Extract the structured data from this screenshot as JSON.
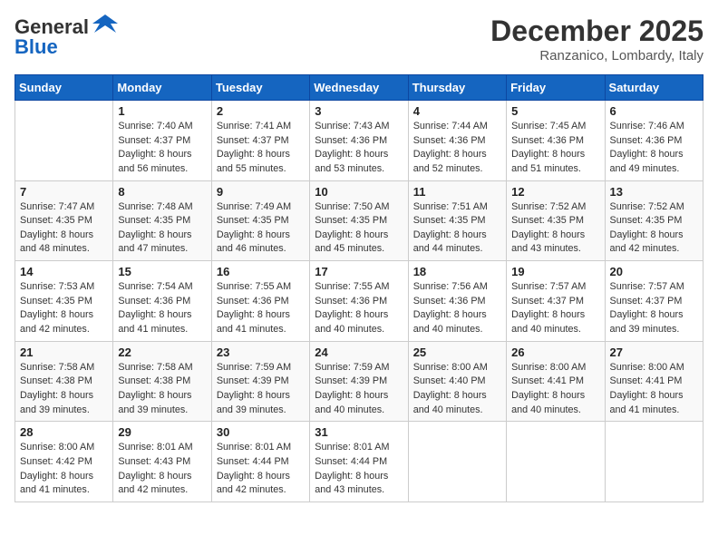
{
  "header": {
    "logo_line1": "General",
    "logo_line2": "Blue",
    "month": "December 2025",
    "location": "Ranzanico, Lombardy, Italy"
  },
  "weekdays": [
    "Sunday",
    "Monday",
    "Tuesday",
    "Wednesday",
    "Thursday",
    "Friday",
    "Saturday"
  ],
  "weeks": [
    [
      {
        "day": "",
        "sunrise": "",
        "sunset": "",
        "daylight": ""
      },
      {
        "day": "1",
        "sunrise": "Sunrise: 7:40 AM",
        "sunset": "Sunset: 4:37 PM",
        "daylight": "Daylight: 8 hours and 56 minutes."
      },
      {
        "day": "2",
        "sunrise": "Sunrise: 7:41 AM",
        "sunset": "Sunset: 4:37 PM",
        "daylight": "Daylight: 8 hours and 55 minutes."
      },
      {
        "day": "3",
        "sunrise": "Sunrise: 7:43 AM",
        "sunset": "Sunset: 4:36 PM",
        "daylight": "Daylight: 8 hours and 53 minutes."
      },
      {
        "day": "4",
        "sunrise": "Sunrise: 7:44 AM",
        "sunset": "Sunset: 4:36 PM",
        "daylight": "Daylight: 8 hours and 52 minutes."
      },
      {
        "day": "5",
        "sunrise": "Sunrise: 7:45 AM",
        "sunset": "Sunset: 4:36 PM",
        "daylight": "Daylight: 8 hours and 51 minutes."
      },
      {
        "day": "6",
        "sunrise": "Sunrise: 7:46 AM",
        "sunset": "Sunset: 4:36 PM",
        "daylight": "Daylight: 8 hours and 49 minutes."
      }
    ],
    [
      {
        "day": "7",
        "sunrise": "Sunrise: 7:47 AM",
        "sunset": "Sunset: 4:35 PM",
        "daylight": "Daylight: 8 hours and 48 minutes."
      },
      {
        "day": "8",
        "sunrise": "Sunrise: 7:48 AM",
        "sunset": "Sunset: 4:35 PM",
        "daylight": "Daylight: 8 hours and 47 minutes."
      },
      {
        "day": "9",
        "sunrise": "Sunrise: 7:49 AM",
        "sunset": "Sunset: 4:35 PM",
        "daylight": "Daylight: 8 hours and 46 minutes."
      },
      {
        "day": "10",
        "sunrise": "Sunrise: 7:50 AM",
        "sunset": "Sunset: 4:35 PM",
        "daylight": "Daylight: 8 hours and 45 minutes."
      },
      {
        "day": "11",
        "sunrise": "Sunrise: 7:51 AM",
        "sunset": "Sunset: 4:35 PM",
        "daylight": "Daylight: 8 hours and 44 minutes."
      },
      {
        "day": "12",
        "sunrise": "Sunrise: 7:52 AM",
        "sunset": "Sunset: 4:35 PM",
        "daylight": "Daylight: 8 hours and 43 minutes."
      },
      {
        "day": "13",
        "sunrise": "Sunrise: 7:52 AM",
        "sunset": "Sunset: 4:35 PM",
        "daylight": "Daylight: 8 hours and 42 minutes."
      }
    ],
    [
      {
        "day": "14",
        "sunrise": "Sunrise: 7:53 AM",
        "sunset": "Sunset: 4:35 PM",
        "daylight": "Daylight: 8 hours and 42 minutes."
      },
      {
        "day": "15",
        "sunrise": "Sunrise: 7:54 AM",
        "sunset": "Sunset: 4:36 PM",
        "daylight": "Daylight: 8 hours and 41 minutes."
      },
      {
        "day": "16",
        "sunrise": "Sunrise: 7:55 AM",
        "sunset": "Sunset: 4:36 PM",
        "daylight": "Daylight: 8 hours and 41 minutes."
      },
      {
        "day": "17",
        "sunrise": "Sunrise: 7:55 AM",
        "sunset": "Sunset: 4:36 PM",
        "daylight": "Daylight: 8 hours and 40 minutes."
      },
      {
        "day": "18",
        "sunrise": "Sunrise: 7:56 AM",
        "sunset": "Sunset: 4:36 PM",
        "daylight": "Daylight: 8 hours and 40 minutes."
      },
      {
        "day": "19",
        "sunrise": "Sunrise: 7:57 AM",
        "sunset": "Sunset: 4:37 PM",
        "daylight": "Daylight: 8 hours and 40 minutes."
      },
      {
        "day": "20",
        "sunrise": "Sunrise: 7:57 AM",
        "sunset": "Sunset: 4:37 PM",
        "daylight": "Daylight: 8 hours and 39 minutes."
      }
    ],
    [
      {
        "day": "21",
        "sunrise": "Sunrise: 7:58 AM",
        "sunset": "Sunset: 4:38 PM",
        "daylight": "Daylight: 8 hours and 39 minutes."
      },
      {
        "day": "22",
        "sunrise": "Sunrise: 7:58 AM",
        "sunset": "Sunset: 4:38 PM",
        "daylight": "Daylight: 8 hours and 39 minutes."
      },
      {
        "day": "23",
        "sunrise": "Sunrise: 7:59 AM",
        "sunset": "Sunset: 4:39 PM",
        "daylight": "Daylight: 8 hours and 39 minutes."
      },
      {
        "day": "24",
        "sunrise": "Sunrise: 7:59 AM",
        "sunset": "Sunset: 4:39 PM",
        "daylight": "Daylight: 8 hours and 40 minutes."
      },
      {
        "day": "25",
        "sunrise": "Sunrise: 8:00 AM",
        "sunset": "Sunset: 4:40 PM",
        "daylight": "Daylight: 8 hours and 40 minutes."
      },
      {
        "day": "26",
        "sunrise": "Sunrise: 8:00 AM",
        "sunset": "Sunset: 4:41 PM",
        "daylight": "Daylight: 8 hours and 40 minutes."
      },
      {
        "day": "27",
        "sunrise": "Sunrise: 8:00 AM",
        "sunset": "Sunset: 4:41 PM",
        "daylight": "Daylight: 8 hours and 41 minutes."
      }
    ],
    [
      {
        "day": "28",
        "sunrise": "Sunrise: 8:00 AM",
        "sunset": "Sunset: 4:42 PM",
        "daylight": "Daylight: 8 hours and 41 minutes."
      },
      {
        "day": "29",
        "sunrise": "Sunrise: 8:01 AM",
        "sunset": "Sunset: 4:43 PM",
        "daylight": "Daylight: 8 hours and 42 minutes."
      },
      {
        "day": "30",
        "sunrise": "Sunrise: 8:01 AM",
        "sunset": "Sunset: 4:44 PM",
        "daylight": "Daylight: 8 hours and 42 minutes."
      },
      {
        "day": "31",
        "sunrise": "Sunrise: 8:01 AM",
        "sunset": "Sunset: 4:44 PM",
        "daylight": "Daylight: 8 hours and 43 minutes."
      },
      {
        "day": "",
        "sunrise": "",
        "sunset": "",
        "daylight": ""
      },
      {
        "day": "",
        "sunrise": "",
        "sunset": "",
        "daylight": ""
      },
      {
        "day": "",
        "sunrise": "",
        "sunset": "",
        "daylight": ""
      }
    ]
  ]
}
